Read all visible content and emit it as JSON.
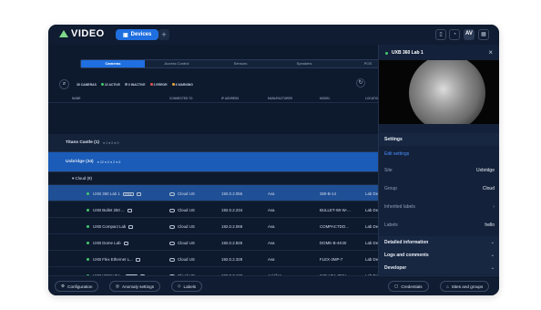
{
  "app": {
    "title": "VIDEO",
    "devices_label": "Devices",
    "plus": "+",
    "avatar": "AV"
  },
  "tabs": [
    "Cameras",
    "Access Control",
    "Sensors",
    "Speakers",
    "POS"
  ],
  "stats": {
    "cameras": "35 CAMERAS",
    "active": "22 ACTIVE",
    "inactive": "0 INACTIVE",
    "error": "2 ERROR",
    "warning": "6 WARNING"
  },
  "columns": [
    "NAME",
    "CONNECTED TO",
    "IP ADDRESS",
    "MANUFACTURER",
    "MODEL",
    "LOCATION"
  ],
  "groups": [
    {
      "name": "Titans Castle (1)",
      "counts": "● 1 ● 0 ● 0"
    },
    {
      "name": "Uxbridge (34)",
      "counts": "● 22 ● 0 ● 2 ● 6"
    }
  ],
  "subgroup": "Cloud (9)",
  "rows": [
    {
      "name": "UXB 360 Lab 1",
      "tag": "FREE",
      "connected": "Cloud US",
      "ip": "192.0.2.056",
      "mfr": "Ava",
      "model": "360-B-14",
      "loc": "Lab De"
    },
    {
      "name": "UXB Bullet 250 ...",
      "tag": "",
      "connected": "Cloud US",
      "ip": "192.0.2.234",
      "mfr": "Ava",
      "model": "BULLET-WI-W-...",
      "loc": "Lab De"
    },
    {
      "name": "UXB Compact Lab",
      "tag": "",
      "connected": "Cloud US",
      "ip": "192.0.2.069",
      "mfr": "Ava",
      "model": "COMPACTDO...",
      "loc": "Lab De"
    },
    {
      "name": "UXB Dome Lab",
      "tag": "",
      "connected": "Cloud US",
      "ip": "192.0.2.825",
      "mfr": "Ava",
      "model": "DOME-B-4K30",
      "loc": "Lab De"
    },
    {
      "name": "UXB Flex Ethernet L...",
      "tag": "",
      "connected": "Cloud US",
      "ip": "192.0.2.329",
      "mfr": "Ava",
      "model": "FLEX-2MP-7",
      "loc": "Lab De"
    },
    {
      "name": "UXB H5MH 3H...",
      "tag": "MULTI",
      "connected": "Cloud US",
      "ip": "192.0.2.122",
      "mfr": "Avigilon",
      "model": "24C-H5A-3MH-...",
      "loc": "Lab De"
    },
    {
      "name": "UXB H6SL Dodgy SD",
      "tag": "",
      "connected": "Cloud US",
      "ip": "192.0.2.341",
      "mfr": "Avigilon",
      "model": "5.0C-H6SL-DO...",
      "loc": "Lab De"
    }
  ],
  "footer": {
    "configuration": "Configuration",
    "anomaly": "Anomaly settings",
    "labels": "Labels",
    "credentials": "Credentials",
    "sites": "Sites and groups"
  },
  "panel": {
    "title": "UXB 360 Lab 1",
    "settings": "Settings",
    "edit": "Edit settings",
    "site_label": "Site",
    "site_value": "Uxbridge",
    "group_label": "Group",
    "group_value": "Cloud",
    "inherited": "Inherited labels",
    "labels_label": "Labels",
    "labels_value": "hello",
    "detailed": "Detailed information",
    "logs": "Logs and comments",
    "developer": "Developer"
  },
  "colors": {
    "accent": "#1f6fe0",
    "active": "#45c86b",
    "error": "#e0554e",
    "warning": "#e8a53a"
  }
}
